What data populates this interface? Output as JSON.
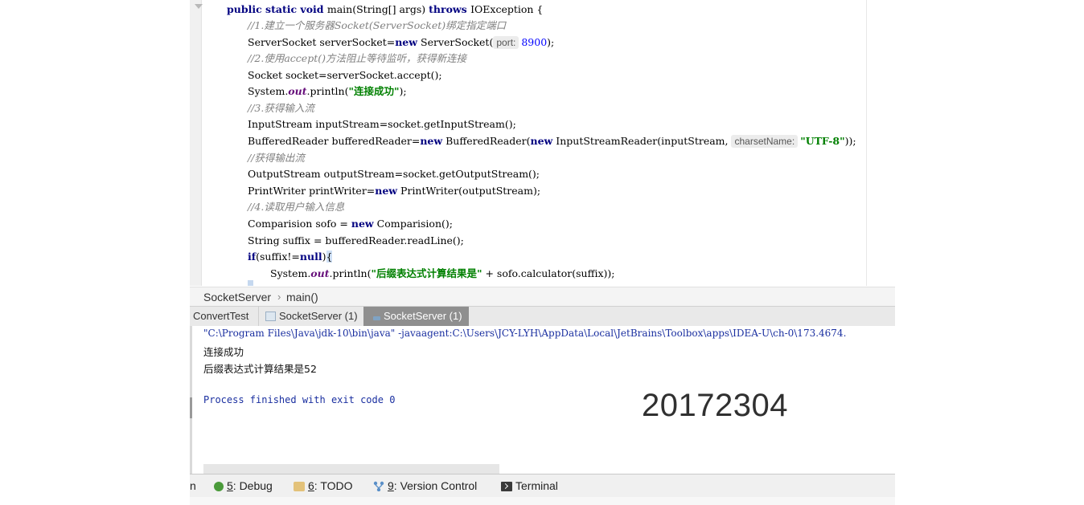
{
  "code": {
    "method_signature": {
      "kw1": "public static void ",
      "name": "main(String[] args) ",
      "kw2": "throws ",
      "rest": "IOException {"
    },
    "c1": "//1.建立一个服务器Socket(ServerSocket)绑定指定端口",
    "l2_pre": "ServerSocket serverSocket=",
    "l2_kw": "new",
    "l2_mid": " ServerSocket(",
    "l2_hint": "port:",
    "l2_num": "8900",
    "l2_post": ");",
    "c2": "//2.使用accept()方法阻止等待监听，获得新连接",
    "l4": "Socket socket=serverSocket.accept();",
    "l5_pre": "System.",
    "l5_fld": "out",
    "l5_mid": ".println(",
    "l5_str": "\"连接成功\"",
    "l5_post": ");",
    "c3": "//3.获得输入流",
    "l7": "InputStream inputStream=socket.getInputStream();",
    "l8_pre": "BufferedReader bufferedReader=",
    "l8_kw1": "new",
    "l8_mid1": " BufferedReader(",
    "l8_kw2": "new",
    "l8_mid2": " InputStreamReader(inputStream, ",
    "l8_hint": "charsetName:",
    "l8_str": "\"UTF-8\"",
    "l8_post": "));",
    "c4": "//获得输出流",
    "l10": "OutputStream outputStream=socket.getOutputStream();",
    "l11_pre": "PrintWriter printWriter=",
    "l11_kw": "new",
    "l11_post": " PrintWriter(outputStream);",
    "c5": "//4.读取用户输入信息",
    "l13_pre": "Comparision sofo = ",
    "l13_kw": "new",
    "l13_post": " Comparision();",
    "l14": "String suffix = bufferedReader.readLine();",
    "l15_kw1": "if",
    "l15_mid": "(suffix!=",
    "l15_kw2": "null",
    "l15_close": ")",
    "l15_brace": "{",
    "l16_pre": "System.",
    "l16_fld": "out",
    "l16_mid": ".println(",
    "l16_str": "\"后缀表达式计算结果是\"",
    "l16_post": " + sofo.calculator(suffix));"
  },
  "breadcrumb": {
    "class_name": "SocketServer",
    "separator": "›",
    "method_name": "main()"
  },
  "run_tabs": [
    {
      "label": "ConvertTest"
    },
    {
      "label": "SocketServer (1)"
    },
    {
      "label": "SocketServer (1)"
    }
  ],
  "console": {
    "command": "\"C:\\Program Files\\Java\\jdk-10\\bin\\java\" -javaagent:C:\\Users\\JCY-LYH\\AppData\\Local\\JetBrains\\Toolbox\\apps\\IDEA-U\\ch-0\\173.4674.",
    "output1": "连接成功",
    "output2": "后缀表达式计算结果是52",
    "exit": "Process finished with exit code 0",
    "watermark": "20172304"
  },
  "toolbar": {
    "left_cut": "n",
    "debug_num": "5",
    "debug_label": ": Debug",
    "todo_num": "6",
    "todo_label": ": TODO",
    "vc_num": "9",
    "vc_label": ": Version Control",
    "terminal_label": "Terminal"
  },
  "colors": {
    "keyword": "#000080",
    "comment": "#808080",
    "string": "#008000",
    "number": "#0000ff",
    "static_field": "#660e7a",
    "console_text": "#1a2fa0",
    "active_tab": "#8f8f8f"
  },
  "icons": [
    "fold-arrow-icon",
    "run-config-icon",
    "bug-icon",
    "todo-icon",
    "version-control-icon",
    "terminal-icon"
  ]
}
